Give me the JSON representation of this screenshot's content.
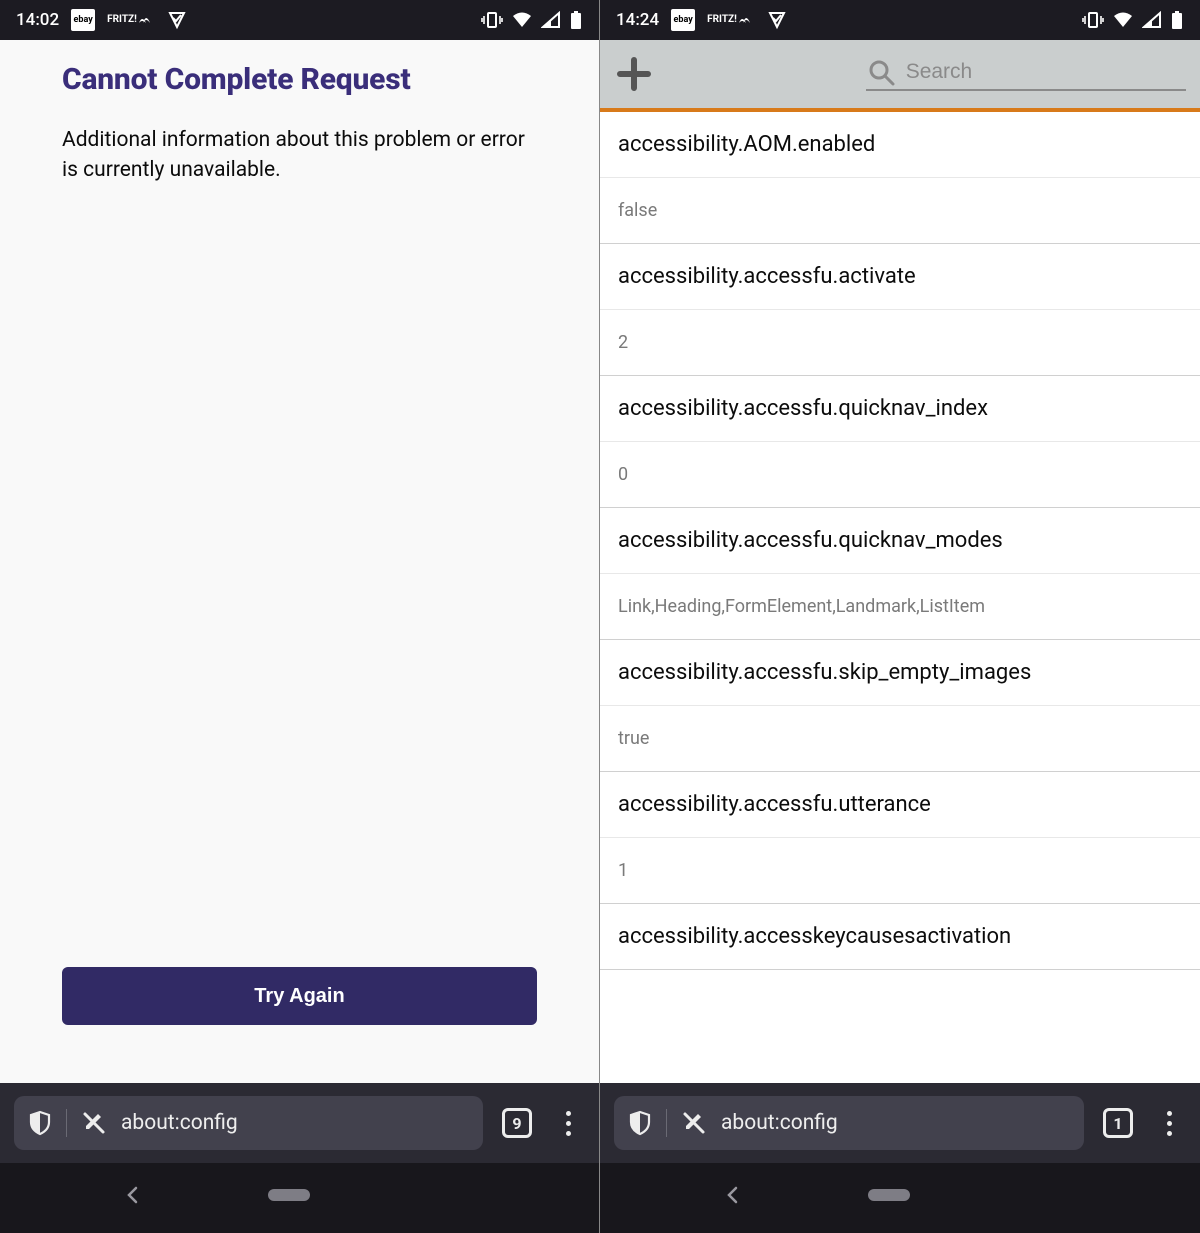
{
  "left": {
    "status": {
      "time": "14:02",
      "app_icons": [
        "ebay",
        "FRITZ!",
        "check"
      ]
    },
    "error": {
      "title": "Cannot Complete Request",
      "description": "Additional information about this problem or error is currently unavailable.",
      "try_again_label": "Try Again"
    },
    "browser_bar": {
      "url": "about:config",
      "tab_count": "9"
    }
  },
  "right": {
    "status": {
      "time": "14:24",
      "app_icons": [
        "ebay",
        "FRITZ!",
        "check"
      ]
    },
    "toolbar": {
      "search_placeholder": "Search"
    },
    "prefs": [
      {
        "name": "accessibility.AOM.enabled",
        "value": "false"
      },
      {
        "name": "accessibility.accessfu.activate",
        "value": "2"
      },
      {
        "name": "accessibility.accessfu.quicknav_index",
        "value": "0"
      },
      {
        "name": "accessibility.accessfu.quicknav_modes",
        "value": "Link,Heading,FormElement,Landmark,ListItem"
      },
      {
        "name": "accessibility.accessfu.skip_empty_images",
        "value": "true"
      },
      {
        "name": "accessibility.accessfu.utterance",
        "value": "1"
      },
      {
        "name": "accessibility.accesskeycausesactivation",
        "value": ""
      }
    ],
    "browser_bar": {
      "url": "about:config",
      "tab_count": "1"
    }
  }
}
